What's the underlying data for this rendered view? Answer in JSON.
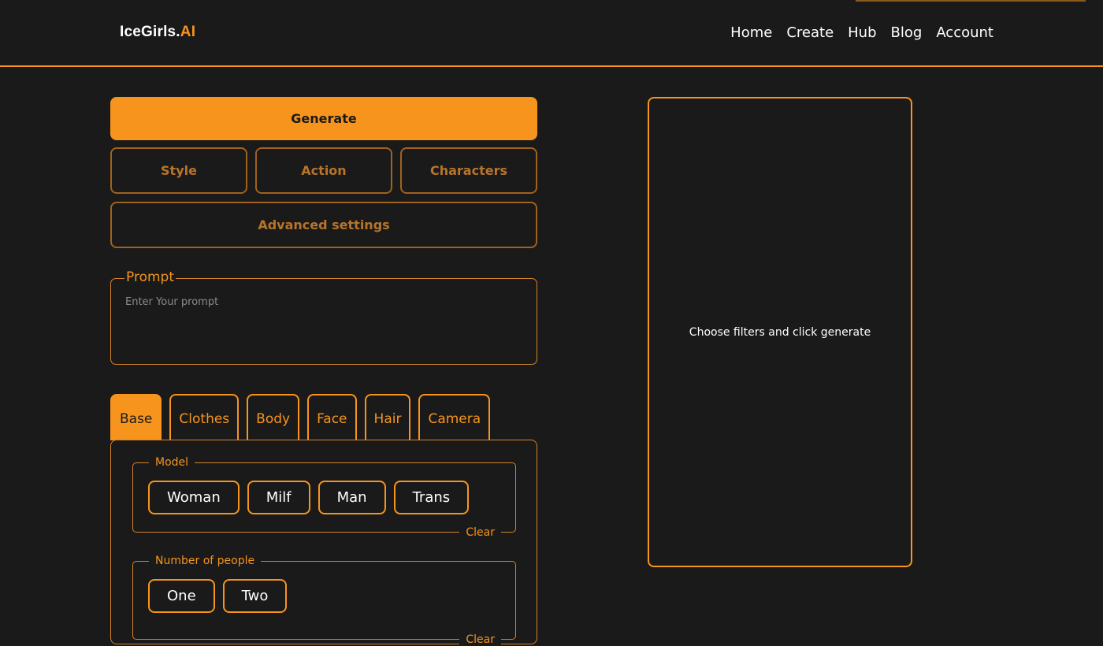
{
  "header": {
    "logo_main": "IceGirls.",
    "logo_accent": "AI",
    "nav": [
      "Home",
      "Create",
      "Hub",
      "Blog",
      "Account"
    ]
  },
  "actions": {
    "generate": "Generate",
    "style": "Style",
    "action": "Action",
    "characters": "Characters",
    "advanced": "Advanced settings"
  },
  "prompt": {
    "legend": "Prompt",
    "placeholder": "Enter Your prompt"
  },
  "tabs": [
    "Base",
    "Clothes",
    "Body",
    "Face",
    "Hair",
    "Camera"
  ],
  "active_tab": "Base",
  "base_panel": {
    "model": {
      "legend": "Model",
      "options": [
        "Woman",
        "Milf",
        "Man",
        "Trans"
      ],
      "clear": "Clear"
    },
    "people": {
      "legend": "Number of people",
      "options": [
        "One",
        "Two"
      ],
      "clear": "Clear"
    }
  },
  "preview": {
    "message": "Choose filters and click generate"
  },
  "colors": {
    "accent": "#f7941d",
    "background": "#1a1a1a",
    "muted_accent": "#b8742a"
  }
}
